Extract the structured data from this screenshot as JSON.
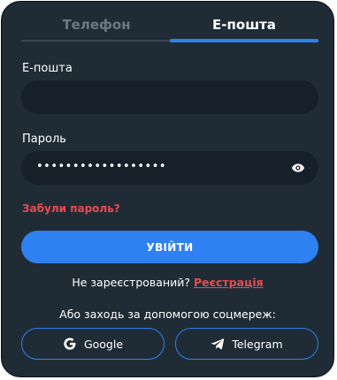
{
  "tabs": [
    {
      "label": "Телефон",
      "active": false
    },
    {
      "label": "Е-пошта",
      "active": true
    }
  ],
  "email": {
    "label": "Е-пошта",
    "value": ""
  },
  "password": {
    "label": "Пароль",
    "value_masked": "••••••••••••••••••"
  },
  "forgot_label": "Забули пароль?",
  "login_label": "УВІЙТИ",
  "register": {
    "question": "Не зареєстрований?",
    "link": "Реєстрація"
  },
  "social": {
    "caption": "Або заходь за допомогою соцмереж:",
    "google": "Google",
    "telegram": "Telegram"
  },
  "colors": {
    "background": "#1f2c36",
    "field": "#15202a",
    "accent": "#2f80f0",
    "danger": "#e84a4f"
  },
  "icons": [
    "eye-icon",
    "google-icon",
    "telegram-icon"
  ]
}
